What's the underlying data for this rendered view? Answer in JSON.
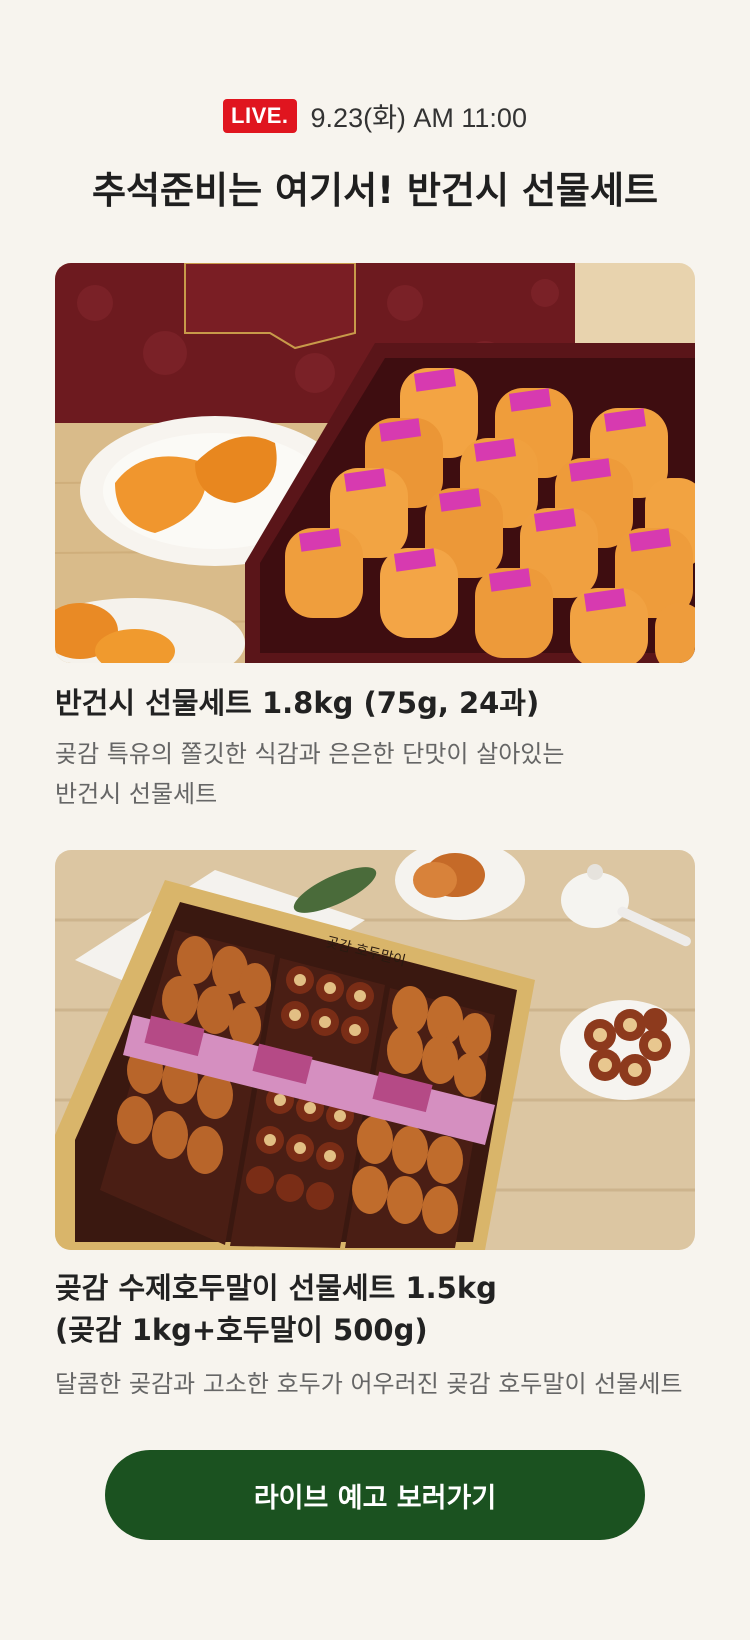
{
  "live": {
    "badge": "LIVE.",
    "datetime": "9.23(화) AM 11:00"
  },
  "headline": "추석준비는 여기서! 반건시 선물세트",
  "products": [
    {
      "title": "반건시 선물세트 1.8kg (75g, 24과)",
      "desc_line1": "곶감 특유의 쫄깃한 식감과 은은한 단맛이 살아있는",
      "desc_line2": "반건시 선물세트"
    },
    {
      "title_line1": "곶감 수제호두말이 선물세트 1.5kg",
      "title_line2": "(곶감 1kg+호두말이 500g)",
      "desc": "달콤한 곶감과 고소한 호두가 어우러진 곶감 호두말이 선물세트"
    }
  ],
  "cta": {
    "label": "라이브 예고 보러가기"
  },
  "colors": {
    "background": "#f7f4ee",
    "live_badge": "#e0151f",
    "cta": "#1b5220"
  }
}
